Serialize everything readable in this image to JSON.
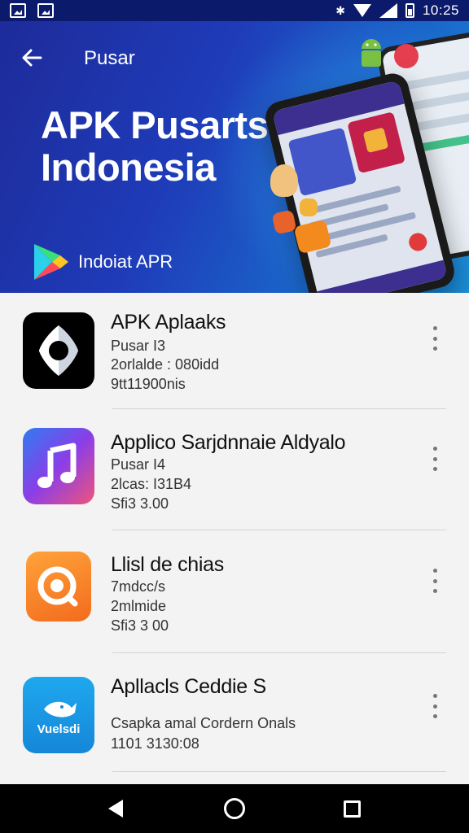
{
  "status_bar": {
    "time": "10:25",
    "icons": [
      "image-icon",
      "gallery-icon",
      "bluetooth-icon",
      "wifi-icon",
      "signal-icon",
      "battery-icon"
    ]
  },
  "banner": {
    "top_title": "Pusar",
    "hero_title": "APK Pusarts Indonesia",
    "brand_text": "Indoiat APR"
  },
  "apps": [
    {
      "title": "APK Aplaaks",
      "line1": "Pusar I3",
      "line2": "2orlalde : 080idd",
      "line3": "9tt11900nis",
      "icon": "eye-icon"
    },
    {
      "title": "Applico Sarjdnnaie Aldyalo",
      "line1": "Pusar I4",
      "line2": "2lcas: I31B4",
      "line3": "Sfi3 3.00",
      "icon": "music-note-icon"
    },
    {
      "title": "Llisl de chias",
      "line1": "7mdcc/s",
      "line2": "2mlmide",
      "line3": "Sfi3 3 00",
      "icon": "search-icon"
    },
    {
      "title": "Apllacls Ceddie S",
      "line1": "Csapka amal Cordern Onals",
      "line2": "1101 3130:08",
      "line3": "",
      "icon": "fish-icon",
      "icon_label": "Vuelsdi"
    }
  ],
  "colors": {
    "banner_start": "#1d2b9a",
    "banner_end": "#1b8fd8",
    "status_bar": "#0b1a6b",
    "nav_bar": "#000000"
  }
}
